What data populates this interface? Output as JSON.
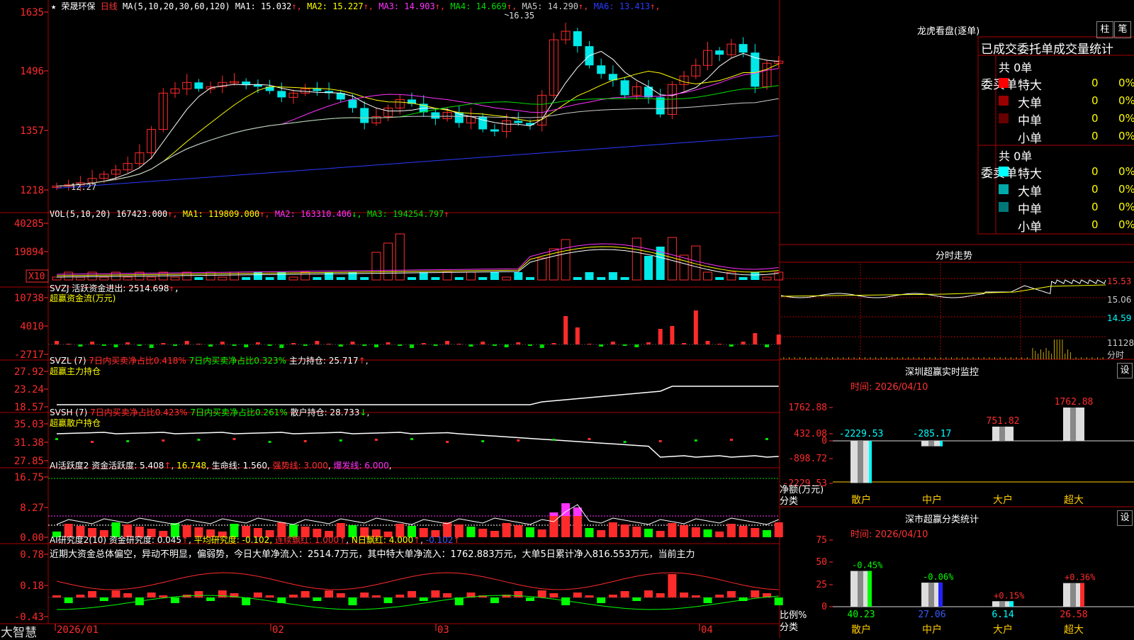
{
  "app": {
    "name": "大智慧",
    "stock_name": "荣晟环保",
    "period": "日线"
  },
  "colors": {
    "up": "#ff2b2b",
    "down": "#00e8e8",
    "grid": "#aa0000",
    "ma1": "#ffffff",
    "ma2": "#ffff00",
    "ma3": "#ff33ff",
    "ma4": "#00dd00",
    "ma5": "#cccccc",
    "ma6": "#2a3bff"
  },
  "price_panel": {
    "header_prefix": "MA(5,10,20,30,60,120)",
    "ma_labels": [
      {
        "text": "MA1: 15.032",
        "color": "#ffffff"
      },
      {
        "text": "MA2: 15.227",
        "color": "#ffff00"
      },
      {
        "text": "MA3: 14.903",
        "color": "#ff33ff"
      },
      {
        "text": "MA4: 14.669",
        "color": "#00dd00"
      },
      {
        "text": "MA5: 14.290",
        "color": "#cccccc"
      },
      {
        "text": "MA6: 13.413",
        "color": "#2a3bff"
      }
    ],
    "y_ticks": [
      "16.35",
      "14.96",
      "13.57",
      "12.18"
    ],
    "high_label": "16.35",
    "low_label": "12.27",
    "y_min": 12.0,
    "y_max": 16.5
  },
  "volume_panel": {
    "header": "VOL(5,10,20)",
    "values": [
      {
        "text": "167423.000",
        "color": "#ffffff"
      },
      {
        "text": "MA1: 119809.000",
        "color": "#ffff00"
      },
      {
        "text": "MA2: 163310.406",
        "color": "#ff33ff"
      },
      {
        "text": "MA3: 194254.797",
        "color": "#00dd00"
      }
    ],
    "y_ticks": [
      "40285",
      "19894"
    ],
    "unit": "X10"
  },
  "svzj_panel": {
    "header": "SVZJ  活跃资金进出: 2514.698",
    "subtitle": "超赢资金流(万元)",
    "y_ticks": [
      "10738",
      "4010",
      "-2717"
    ]
  },
  "svzl_panel": {
    "header": "SVZL (7)",
    "t1": "7日内买卖净占比0.418%",
    "t2": "7日内买卖净占比0.323%",
    "t3": "主力持仓: 25.717",
    "subtitle": "超赢主力持仓",
    "y_ticks": [
      "27.92",
      "23.24",
      "18.57"
    ]
  },
  "svsh_panel": {
    "header": "SVSH (7)",
    "t1": "7日内买卖净占比0.423%",
    "t2": "7日内买卖净占比0.261%",
    "t3": "散户持仓: 28.733",
    "subtitle": "超赢散户持仓",
    "y_ticks": [
      "35.03",
      "31.38",
      "27.85"
    ]
  },
  "ai_active_panel": {
    "header": "AI活跃度2  资金活跃度: 5.408",
    "v2": "16.748",
    "v3": "生命线: 1.560",
    "v4": "强势线: 3.000",
    "v5": "爆发线: 6.000",
    "y_ticks": [
      "16.75",
      "8.27",
      "0.00"
    ]
  },
  "ai_research_panel": {
    "header": "AI研究度2(10)  资金研究度: 0.045",
    "v2": "平均研究度: -0.102",
    "v3": "连续飘红: 1.000",
    "v4": "N日飘红: 4.000",
    "v5": "-0.102",
    "commentary": "近期大资金总体偏空，异动不明显，偏弱势，今日大单净流入：2514.7万元，其中特大单净流入：1762.883万元，大单5日累计净入816.553万元，当前主力",
    "y_ticks": [
      "0.78",
      "0.18",
      "-0.43"
    ]
  },
  "x_axis": {
    "labels": [
      "2026/01",
      "02",
      "03",
      "04"
    ]
  },
  "longhu": {
    "title": "龙虎看盘(逐单)",
    "btn1": "柱",
    "btn2": "笔",
    "tabs": "已成交委托单成交量统计",
    "buy_label": "委买单",
    "sell_label": "委卖单",
    "buy_total": "共 0单",
    "sell_total": "共 0单",
    "buy_rows": [
      {
        "name": "特大",
        "count": "0",
        "pct": "0%",
        "color": "#ff0000"
      },
      {
        "name": "大单",
        "count": "0",
        "pct": "0%",
        "color": "#990000"
      },
      {
        "name": "中单",
        "count": "0",
        "pct": "0%",
        "color": "#660000"
      },
      {
        "name": "小单",
        "count": "0",
        "pct": "0%",
        "color": ""
      }
    ],
    "sell_rows": [
      {
        "name": "特大",
        "count": "0",
        "pct": "0%",
        "color": "#00ffff"
      },
      {
        "name": "大单",
        "count": "0",
        "pct": "0%",
        "color": "#00aaaa"
      },
      {
        "name": "中单",
        "count": "0",
        "pct": "0%",
        "color": "#007777"
      },
      {
        "name": "小单",
        "count": "0",
        "pct": "0%",
        "color": ""
      }
    ]
  },
  "intraday": {
    "title": "分时走势",
    "price_labels": [
      "15.53",
      "15.06",
      "14.59"
    ],
    "vol_label": "11128",
    "vol_label2": "分时"
  },
  "sz_monitor": {
    "title": "深圳超赢实时监控",
    "set_btn": "设",
    "time": "时间: 2026/04/10",
    "y_ticks": [
      "1762.88",
      "432.08",
      "0",
      "-898.72",
      "-2229.53"
    ],
    "axis_title": "净额(万元)",
    "axis_sub": "分类",
    "bars": [
      {
        "label": "散户",
        "value": -2229.53,
        "text": "-2229.53",
        "color": "#00ffff"
      },
      {
        "label": "中户",
        "value": -285.17,
        "text": "-285.17",
        "color": "#00ffff"
      },
      {
        "label": "大户",
        "value": 751.82,
        "text": "751.82",
        "color": "#ff2b2b"
      },
      {
        "label": "超大",
        "value": 1762.88,
        "text": "1762.88",
        "color": "#ff2b2b"
      }
    ]
  },
  "sz_stats": {
    "title": "深市超赢分类统计",
    "set_btn": "设",
    "time": "时间: 2026/04/10",
    "y_ticks": [
      "75",
      "50",
      "25",
      "0"
    ],
    "axis_title": "比例%",
    "axis_sub": "分类",
    "bars": [
      {
        "label": "散户",
        "value": 40.23,
        "text": "40.23",
        "change": "-0.45%",
        "color": "#00ff00"
      },
      {
        "label": "中户",
        "value": 27.06,
        "text": "27.06",
        "change": "-0.06%",
        "color": "#2222ff"
      },
      {
        "label": "大户",
        "value": 6.14,
        "text": "6.14",
        "change": "+0.15%",
        "color": "#00ffff"
      },
      {
        "label": "超大",
        "value": 26.58,
        "text": "26.58",
        "change": "+0.36%",
        "color": "#ff2b2b"
      }
    ]
  }
}
